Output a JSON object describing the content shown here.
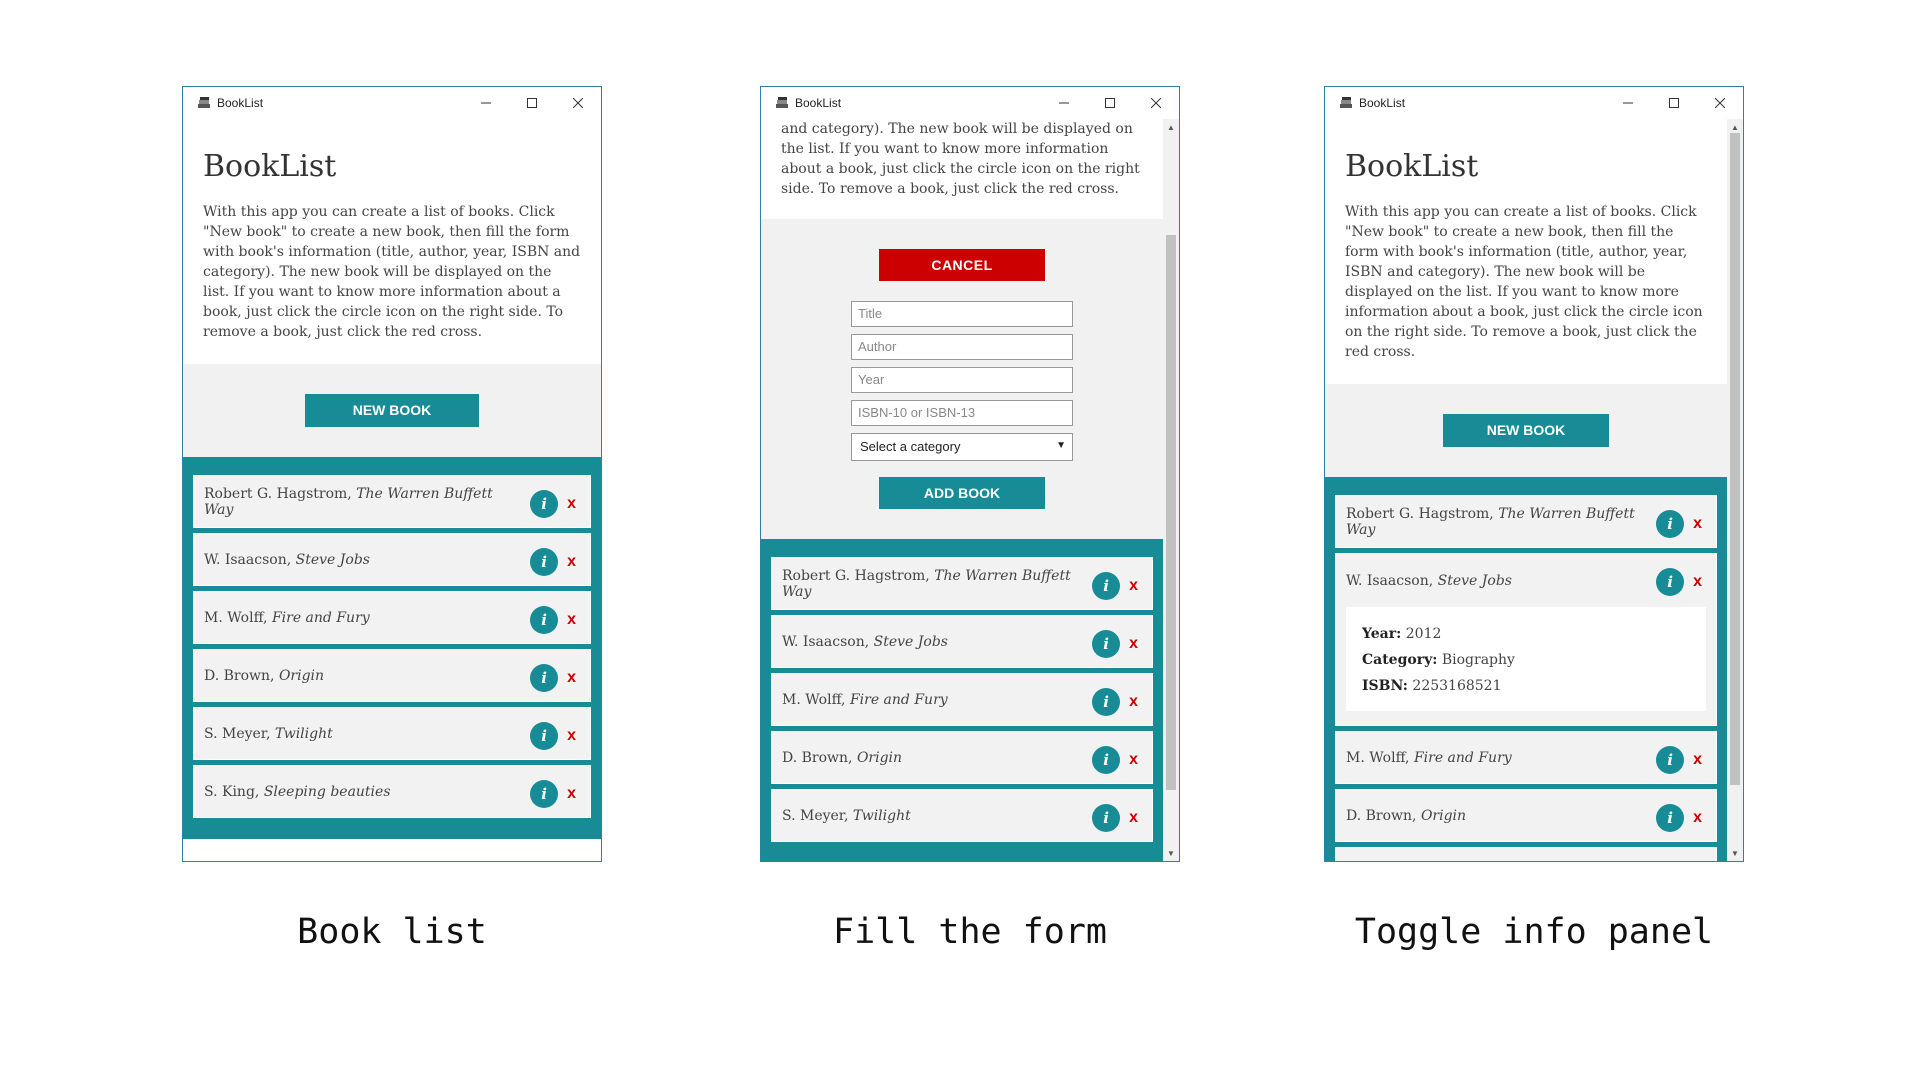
{
  "colors": {
    "teal": "#178c96",
    "red": "#cc0000",
    "panel": "#f1f1f1",
    "border": "#2f7fa5"
  },
  "window": {
    "title": "BookList",
    "icon": "books-icon",
    "minimize": "—",
    "maximize": "☐",
    "close": "✕"
  },
  "app": {
    "heading": "BookList",
    "intro1": "With this app you can create a list of books. Click \"New book\" to create a new book, then fill the form with book's information (title, author, year, ISBN and category). The new book will be displayed on the list. If you want to know more information about a book, just click the circle icon on the right side. To remove a book, just click the red cross.",
    "intro_tail": "and category). The new book will be displayed on the list. If you want to know more information about a book, just click the circle icon on the right side. To remove a book, just click the red cross.",
    "new_book_label": "NEW BOOK",
    "cancel_label": "CANCEL",
    "add_book_label": "ADD BOOK",
    "info_icon": "i",
    "delete_icon": "x"
  },
  "form": {
    "title_placeholder": "Title",
    "author_placeholder": "Author",
    "year_placeholder": "Year",
    "isbn_placeholder": "ISBN-10 or ISBN-13",
    "category_selected": "Select a category"
  },
  "books": [
    {
      "author": "Robert G. Hagstrom, ",
      "title": "The Warren Buffett Way"
    },
    {
      "author": "W. Isaacson, ",
      "title": "Steve Jobs"
    },
    {
      "author": "M. Wolff, ",
      "title": "Fire and Fury"
    },
    {
      "author": "D. Brown, ",
      "title": "Origin"
    },
    {
      "author": "S. Meyer, ",
      "title": "Twilight"
    },
    {
      "author": "S. King, ",
      "title": "Sleeping beauties"
    }
  ],
  "info_panel": {
    "year_label": "Year:",
    "year": "2012",
    "category_label": "Category:",
    "category": "Biography",
    "isbn_label": "ISBN:",
    "isbn": "2253168521"
  },
  "captions": {
    "c1": "Book list",
    "c2": "Fill the form",
    "c3": "Toggle info panel"
  }
}
